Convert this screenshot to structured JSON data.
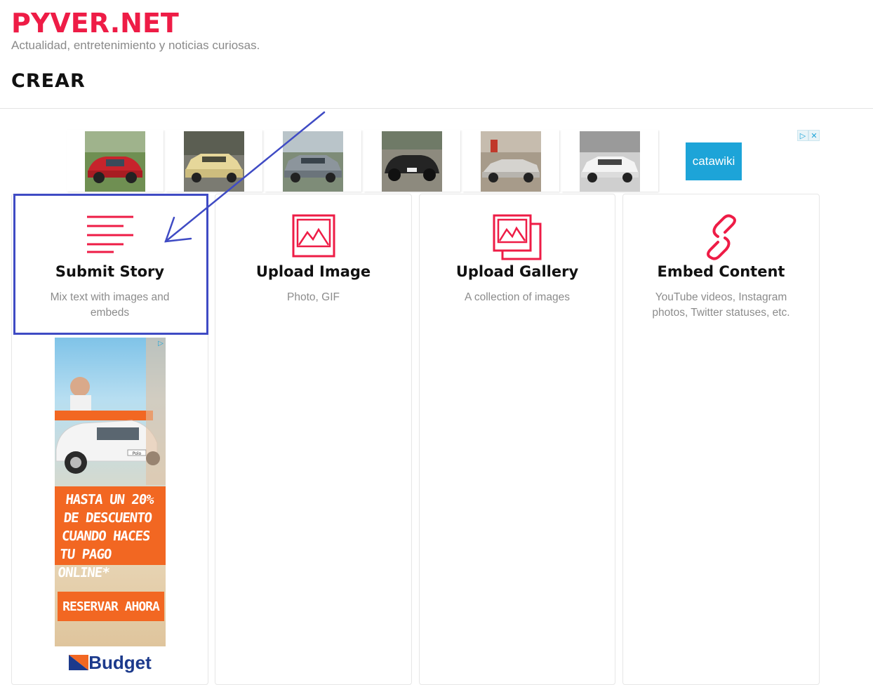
{
  "site": {
    "logo": "PYVER.NET",
    "tagline": "Actualidad, entretenimiento y noticias curiosas.",
    "page_title": "CREAR"
  },
  "colors": {
    "brand": "#ee1c46",
    "highlight": "#3f4bc4",
    "ad_blue": "#1da4d8",
    "ad_orange": "#f26722"
  },
  "top_ad": {
    "brand": "catawiki",
    "thumbnails": [
      "red-classic-car",
      "beige-sedan",
      "silver-sedan",
      "black-convertible-beetle",
      "silver-sports-car",
      "white-rally-car"
    ]
  },
  "cards": [
    {
      "title": "Submit Story",
      "description": "Mix text with images and embeds",
      "icon": "text-lines-icon"
    },
    {
      "title": "Upload Image",
      "description": "Photo, GIF",
      "icon": "image-icon"
    },
    {
      "title": "Upload Gallery",
      "description": "A collection of images",
      "icon": "gallery-icon"
    },
    {
      "title": "Embed Content",
      "description": "YouTube videos, Instagram photos, Twitter statuses, etc.",
      "icon": "link-icon"
    }
  ],
  "side_ad": {
    "headline": "HASTA UN 20% DE DESCUENTO CUANDO HACES TU PAGO ONLINE*",
    "cta": "RESERVAR AHORA",
    "brand": "Budget",
    "car_badge": "Polo"
  }
}
